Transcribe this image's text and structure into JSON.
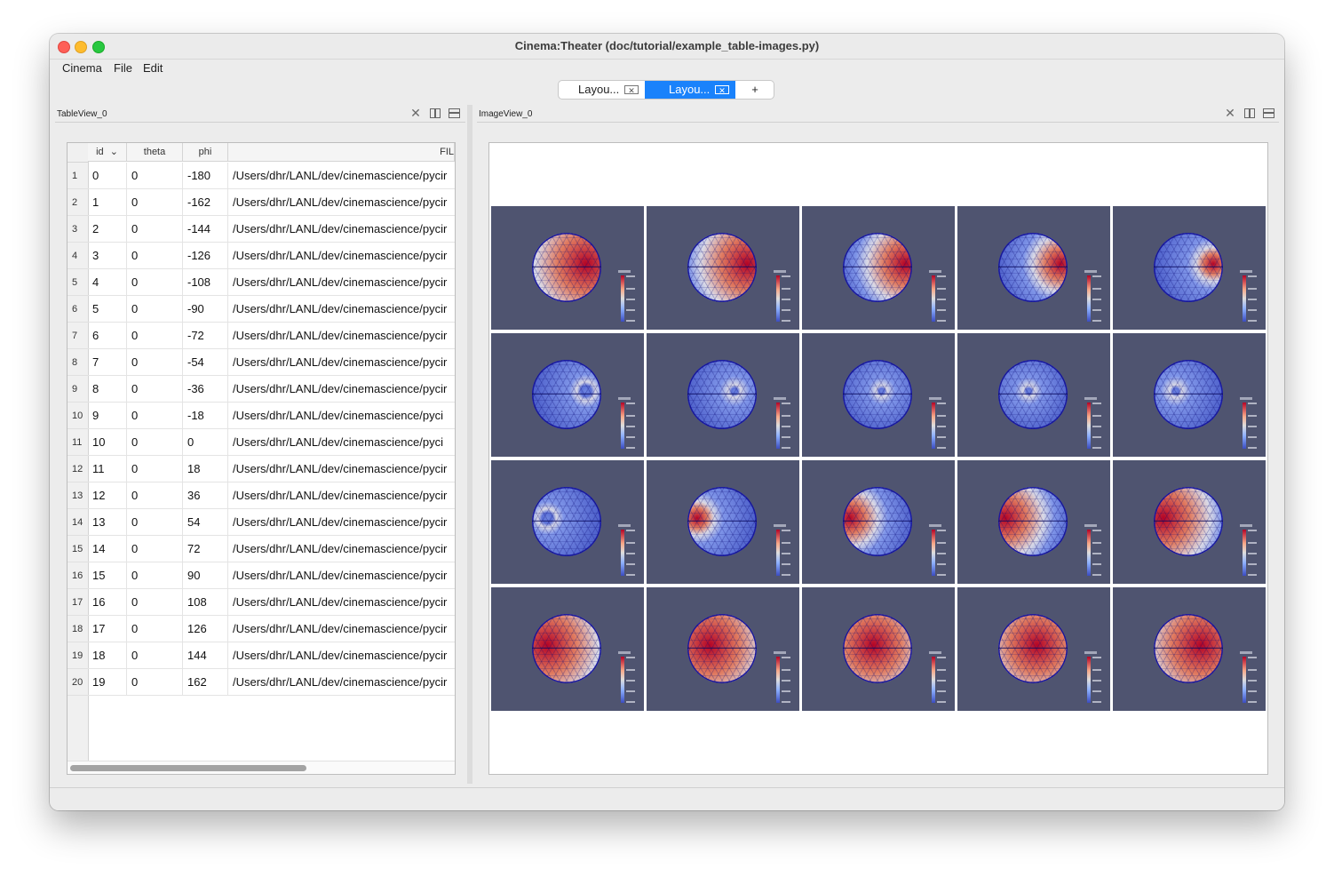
{
  "window": {
    "title": "Cinema:Theater (doc/tutorial/example_table-images.py)"
  },
  "menu": [
    "Cinema",
    "File",
    "Edit"
  ],
  "tabs": [
    {
      "label": "Layou...",
      "close": "✕",
      "active": false
    },
    {
      "label": "Layou...",
      "close": "✕",
      "active": true
    },
    {
      "label": "+"
    }
  ],
  "table_panel": {
    "title": "TableView_0",
    "columns": [
      "id",
      "theta",
      "phi",
      "FIL"
    ],
    "sort_indicator": "⌄",
    "rows": [
      [
        "1",
        "0",
        "0",
        "-180",
        "/Users/dhr/LANL/dev/cinemascience/pycir"
      ],
      [
        "2",
        "1",
        "0",
        "-162",
        "/Users/dhr/LANL/dev/cinemascience/pycir"
      ],
      [
        "3",
        "2",
        "0",
        "-144",
        "/Users/dhr/LANL/dev/cinemascience/pycir"
      ],
      [
        "4",
        "3",
        "0",
        "-126",
        "/Users/dhr/LANL/dev/cinemascience/pycir"
      ],
      [
        "5",
        "4",
        "0",
        "-108",
        "/Users/dhr/LANL/dev/cinemascience/pycir"
      ],
      [
        "6",
        "5",
        "0",
        "-90",
        "/Users/dhr/LANL/dev/cinemascience/pycir"
      ],
      [
        "7",
        "6",
        "0",
        "-72",
        "/Users/dhr/LANL/dev/cinemascience/pycir"
      ],
      [
        "8",
        "7",
        "0",
        "-54",
        "/Users/dhr/LANL/dev/cinemascience/pycir"
      ],
      [
        "9",
        "8",
        "0",
        "-36",
        "/Users/dhr/LANL/dev/cinemascience/pycir"
      ],
      [
        "10",
        "9",
        "0",
        "-18",
        "/Users/dhr/LANL/dev/cinemascience/pyci"
      ],
      [
        "11",
        "10",
        "0",
        "0",
        "/Users/dhr/LANL/dev/cinemascience/pyci"
      ],
      [
        "12",
        "11",
        "0",
        "18",
        "/Users/dhr/LANL/dev/cinemascience/pycir"
      ],
      [
        "13",
        "12",
        "0",
        "36",
        "/Users/dhr/LANL/dev/cinemascience/pycir"
      ],
      [
        "14",
        "13",
        "0",
        "54",
        "/Users/dhr/LANL/dev/cinemascience/pycir"
      ],
      [
        "15",
        "14",
        "0",
        "72",
        "/Users/dhr/LANL/dev/cinemascience/pycir"
      ],
      [
        "16",
        "15",
        "0",
        "90",
        "/Users/dhr/LANL/dev/cinemascience/pycir"
      ],
      [
        "17",
        "16",
        "0",
        "108",
        "/Users/dhr/LANL/dev/cinemascience/pycir"
      ],
      [
        "18",
        "17",
        "0",
        "126",
        "/Users/dhr/LANL/dev/cinemascience/pycir"
      ],
      [
        "19",
        "18",
        "0",
        "144",
        "/Users/dhr/LANL/dev/cinemascience/pycir"
      ],
      [
        "20",
        "19",
        "0",
        "162",
        "/Users/dhr/LANL/dev/cinemascience/pycir"
      ]
    ]
  },
  "image_panel": {
    "title": "ImageView_0",
    "phi_values": [
      -180,
      -162,
      -144,
      -126,
      -108,
      -90,
      -72,
      -54,
      -36,
      -18,
      0,
      18,
      36,
      54,
      72,
      90,
      108,
      126,
      144,
      162
    ]
  },
  "icons": {
    "close": "close-icon",
    "split_vertical": "split-vertical-icon",
    "split_horizontal": "split-horizontal-icon"
  },
  "colors": {
    "accent": "#1a82fb",
    "thumb_bg": "#4f5470",
    "warm": "#b40426",
    "cool": "#3b4cc0"
  }
}
